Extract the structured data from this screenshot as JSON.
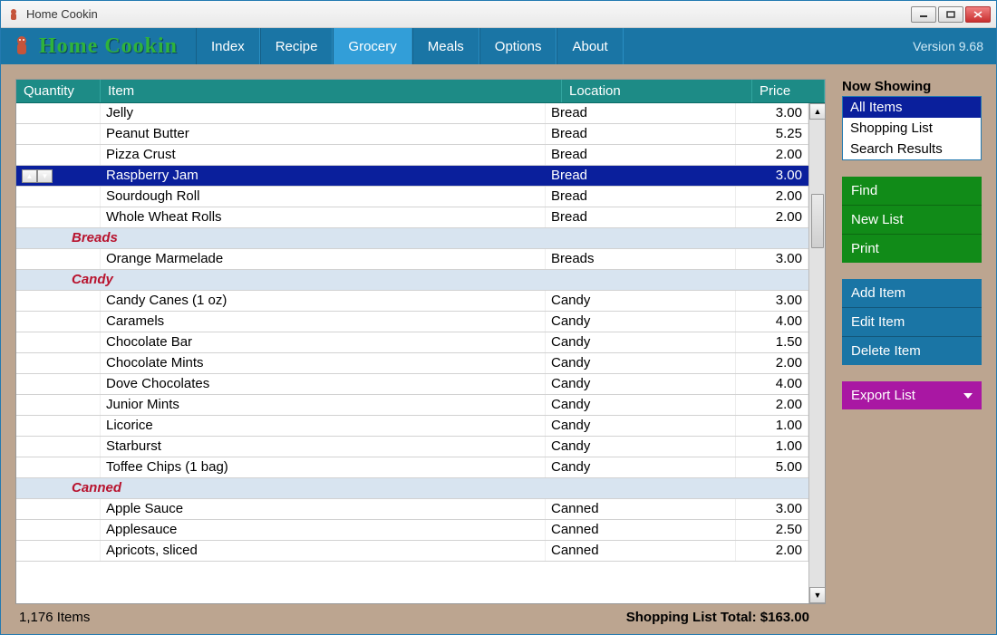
{
  "window": {
    "title": "Home Cookin"
  },
  "logo": {
    "text": "Home Cookin"
  },
  "menu": {
    "items": [
      "Index",
      "Recipe",
      "Grocery",
      "Meals",
      "Options",
      "About"
    ],
    "active_index": 2
  },
  "version": "Version 9.68",
  "table": {
    "headers": {
      "quantity": "Quantity",
      "item": "Item",
      "location": "Location",
      "price": "Price"
    },
    "rows": [
      {
        "type": "item",
        "item": "Jelly",
        "location": "Bread",
        "price": "3.00"
      },
      {
        "type": "item",
        "item": "Peanut Butter",
        "location": "Bread",
        "price": "5.25"
      },
      {
        "type": "item",
        "item": "Pizza Crust",
        "location": "Bread",
        "price": "2.00"
      },
      {
        "type": "item",
        "item": "Raspberry Jam",
        "location": "Bread",
        "price": "3.00",
        "selected": true
      },
      {
        "type": "item",
        "item": "Sourdough Roll",
        "location": "Bread",
        "price": "2.00"
      },
      {
        "type": "item",
        "item": "Whole Wheat Rolls",
        "location": "Bread",
        "price": "2.00"
      },
      {
        "type": "section",
        "label": "Breads"
      },
      {
        "type": "item",
        "item": "Orange Marmelade",
        "location": "Breads",
        "price": "3.00"
      },
      {
        "type": "section",
        "label": "Candy"
      },
      {
        "type": "item",
        "item": "Candy Canes (1 oz)",
        "location": "Candy",
        "price": "3.00"
      },
      {
        "type": "item",
        "item": "Caramels",
        "location": "Candy",
        "price": "4.00"
      },
      {
        "type": "item",
        "item": "Chocolate Bar",
        "location": "Candy",
        "price": "1.50"
      },
      {
        "type": "item",
        "item": "Chocolate Mints",
        "location": "Candy",
        "price": "2.00"
      },
      {
        "type": "item",
        "item": "Dove Chocolates",
        "location": "Candy",
        "price": "4.00"
      },
      {
        "type": "item",
        "item": "Junior Mints",
        "location": "Candy",
        "price": "2.00"
      },
      {
        "type": "item",
        "item": "Licorice",
        "location": "Candy",
        "price": "1.00"
      },
      {
        "type": "item",
        "item": "Starburst",
        "location": "Candy",
        "price": "1.00"
      },
      {
        "type": "item",
        "item": "Toffee Chips (1 bag)",
        "location": "Candy",
        "price": "5.00"
      },
      {
        "type": "section",
        "label": "Canned"
      },
      {
        "type": "item",
        "item": "Apple Sauce",
        "location": "Canned",
        "price": "3.00"
      },
      {
        "type": "item",
        "item": "Applesauce",
        "location": "Canned",
        "price": "2.50"
      },
      {
        "type": "item",
        "item": "Apricots, sliced",
        "location": "Canned",
        "price": "2.00"
      }
    ]
  },
  "status": {
    "count": "1,176 Items",
    "total": "Shopping List Total: $163.00"
  },
  "filters": {
    "title": "Now Showing",
    "items": [
      "All Items",
      "Shopping List",
      "Search Results"
    ],
    "selected_index": 0
  },
  "buttons": {
    "green": [
      "Find",
      "New List",
      "Print"
    ],
    "blue": [
      "Add Item",
      "Edit Item",
      "Delete Item"
    ],
    "purple": [
      "Export List"
    ]
  }
}
